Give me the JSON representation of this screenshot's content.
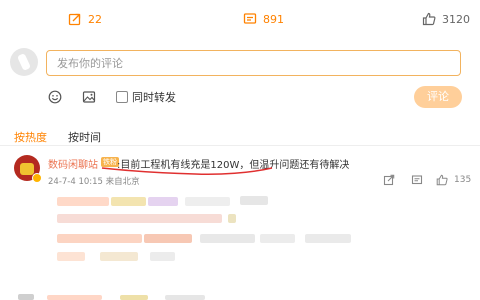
{
  "post_stats": {
    "repost_count": "22",
    "comment_count": "891",
    "like_count": "3120"
  },
  "composer": {
    "placeholder": "发布你的评论",
    "repost_label": "同时转发",
    "submit_label": "评论"
  },
  "sort_tabs": [
    {
      "label": "按热度",
      "active": true
    },
    {
      "label": "按时间",
      "active": false
    }
  ],
  "comment": {
    "username": "数码闲聊站",
    "fan_badge": "铁粉",
    "text": ":目前工程机有线充是120W，但温升问题还有待解决",
    "time_location": "24-7-4 10:15 来自北京",
    "like_count": "135"
  },
  "colors": {
    "accent": "#ff8200",
    "submit_disabled": "#ffcf9a",
    "username": "#eb7350",
    "annotation": "#e03030"
  },
  "icons": [
    "repost-icon",
    "comment-icon",
    "like-icon",
    "emoji-icon",
    "image-icon",
    "share-icon",
    "reply-icon"
  ]
}
